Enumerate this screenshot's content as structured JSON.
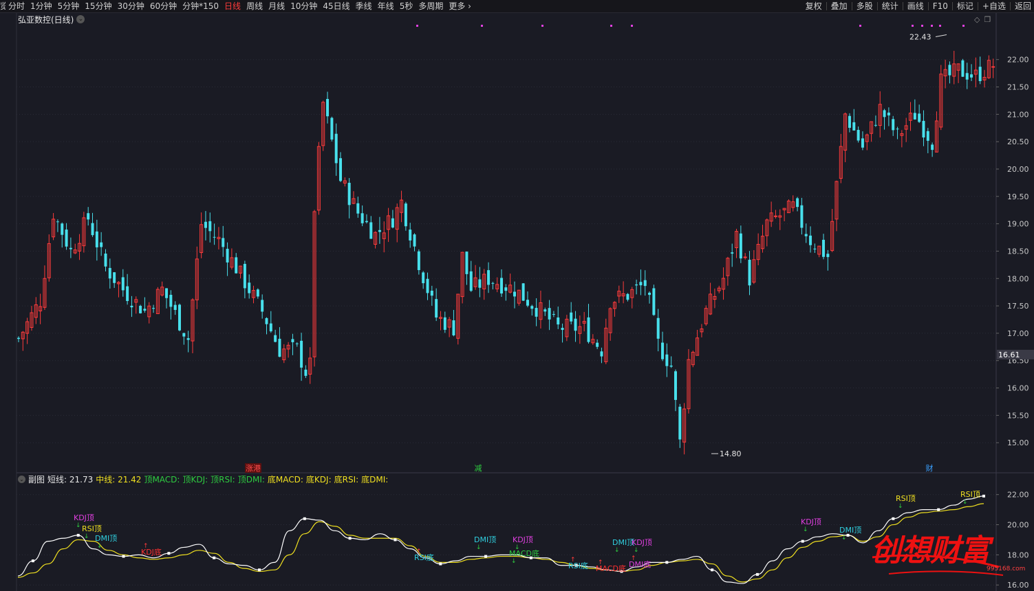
{
  "toolbar": {
    "left_items": [
      {
        "label": "览",
        "active": false,
        "clip": true
      },
      {
        "label": "分时",
        "active": false
      },
      {
        "label": "1分钟",
        "active": false
      },
      {
        "label": "5分钟",
        "active": false
      },
      {
        "label": "15分钟",
        "active": false
      },
      {
        "label": "30分钟",
        "active": false
      },
      {
        "label": "60分钟",
        "active": false
      },
      {
        "label": "分钟*150",
        "active": false
      },
      {
        "label": "日线",
        "active": true
      },
      {
        "label": "周线",
        "active": false
      },
      {
        "label": "月线",
        "active": false
      },
      {
        "label": "10分钟",
        "active": false
      },
      {
        "label": "45日线",
        "active": false
      },
      {
        "label": "季线",
        "active": false
      },
      {
        "label": "年线",
        "active": false
      },
      {
        "label": "5秒",
        "active": false
      },
      {
        "label": "多周期",
        "active": false
      },
      {
        "label": "更多 ›",
        "active": false
      }
    ],
    "right_items": [
      "复权",
      "叠加",
      "多股",
      "统计",
      "画线",
      "F10",
      "标记",
      "+自选",
      "返回"
    ]
  },
  "title": {
    "text": "弘亚数控(日线)",
    "dropdown": "⌄"
  },
  "panel_icons": [
    "◇",
    "❐"
  ],
  "price_axis": {
    "labels": [
      "22.00",
      "21.50",
      "21.00",
      "20.50",
      "20.00",
      "19.50",
      "19.00",
      "18.50",
      "18.00",
      "17.50",
      "17.00",
      "16.50",
      "16.00",
      "15.50",
      "15.00"
    ],
    "current": "16.61",
    "min": 14.45,
    "max": 22.85
  },
  "annotations": {
    "high": "22.43",
    "low": "14.80"
  },
  "event_markers": [
    {
      "text": "涨港",
      "color": "#ff4d4d",
      "bg": "#5a1010"
    },
    {
      "text": "减",
      "color": "#2ecc40",
      "bg": ""
    },
    {
      "text": "财",
      "color": "#3aa0ff",
      "bg": ""
    }
  ],
  "sub_chart": {
    "legend_name": "副图",
    "items": [
      {
        "text": "短线: 21.73",
        "color": "#e6e6e6"
      },
      {
        "text": "中线: 21.42",
        "color": "#f0e020"
      },
      {
        "text": "顶MACD:",
        "color": "#2ecc40"
      },
      {
        "text": "顶KDJ:",
        "color": "#2ecc40"
      },
      {
        "text": "顶RSI:",
        "color": "#2ecc40"
      },
      {
        "text": "顶DMI:",
        "color": "#2ecc40"
      },
      {
        "text": "底MACD:",
        "color": "#f0e020"
      },
      {
        "text": "底KDJ:",
        "color": "#f0e020"
      },
      {
        "text": "底RSI:",
        "color": "#f0e020"
      },
      {
        "text": "底DMI:",
        "color": "#f0e020"
      }
    ],
    "axis_labels": [
      "22.00",
      "20.00",
      "18.00",
      "16.00"
    ],
    "min": 15.6,
    "max": 23.4,
    "signals": [
      {
        "text": "KDJ顶",
        "color": "#e040e0"
      },
      {
        "text": "RSI顶",
        "color": "#f0e020"
      },
      {
        "text": "DMI顶",
        "color": "#30d0e0"
      },
      {
        "text": "KDJ底",
        "color": "#ff3030"
      },
      {
        "text": "RSI底",
        "color": "#30d0e0"
      },
      {
        "text": "DMI顶",
        "color": "#30d0e0"
      },
      {
        "text": "KDJ顶",
        "color": "#e040e0"
      },
      {
        "text": "MACD底",
        "color": "#2ecc40"
      },
      {
        "text": "RSI底",
        "color": "#30d0e0"
      },
      {
        "text": "MACD底",
        "color": "#ff3030"
      },
      {
        "text": "DMI顶",
        "color": "#30d0e0"
      },
      {
        "text": "KDJ顶",
        "color": "#e040e0"
      },
      {
        "text": "DMI底",
        "color": "#e040e0"
      },
      {
        "text": "KDJ顶",
        "color": "#e040e0"
      },
      {
        "text": "DMI顶",
        "color": "#30d0e0"
      },
      {
        "text": "RSI顶",
        "color": "#f0e020"
      },
      {
        "text": "RSI顶",
        "color": "#f0e020"
      }
    ],
    "short_line": [
      16.6,
      17.6,
      18.9,
      19.1,
      19.3,
      18.4,
      18.0,
      17.9,
      18.0,
      17.8,
      18.1,
      18.5,
      18.7,
      17.8,
      17.4,
      17.3,
      17.0,
      17.5,
      19.6,
      20.4,
      20.3,
      19.6,
      19.1,
      19.0,
      19.4,
      19.0,
      18.4,
      17.8,
      17.4,
      17.6,
      17.9,
      17.9,
      18.0,
      18.0,
      17.8,
      17.8,
      17.3,
      17.3,
      17.2,
      17.0,
      16.9,
      17.2,
      17.5,
      17.5,
      17.7,
      17.9,
      17.0,
      16.2,
      16.1,
      16.7,
      17.6,
      18.4,
      18.9,
      19.2,
      19.4,
      19.3,
      18.8,
      19.6,
      20.4,
      20.8,
      21.0,
      21.0,
      21.3,
      21.7,
      21.9
    ],
    "mid_line": [
      16.5,
      16.8,
      17.4,
      18.4,
      19.0,
      18.9,
      18.3,
      18.0,
      17.8,
      17.7,
      17.8,
      18.0,
      18.3,
      18.1,
      17.5,
      17.1,
      16.9,
      17.0,
      18.0,
      19.4,
      20.2,
      19.9,
      19.3,
      19.1,
      19.1,
      19.1,
      18.6,
      17.9,
      17.5,
      17.5,
      17.7,
      17.8,
      17.9,
      17.9,
      17.8,
      17.7,
      17.5,
      17.3,
      17.1,
      17.0,
      16.9,
      17.0,
      17.3,
      17.5,
      17.6,
      17.7,
      17.4,
      16.6,
      16.2,
      16.4,
      17.0,
      17.8,
      18.5,
      18.9,
      19.2,
      19.3,
      18.9,
      19.2,
      20.0,
      20.5,
      20.8,
      20.9,
      21.0,
      21.2,
      21.4
    ]
  }
}
